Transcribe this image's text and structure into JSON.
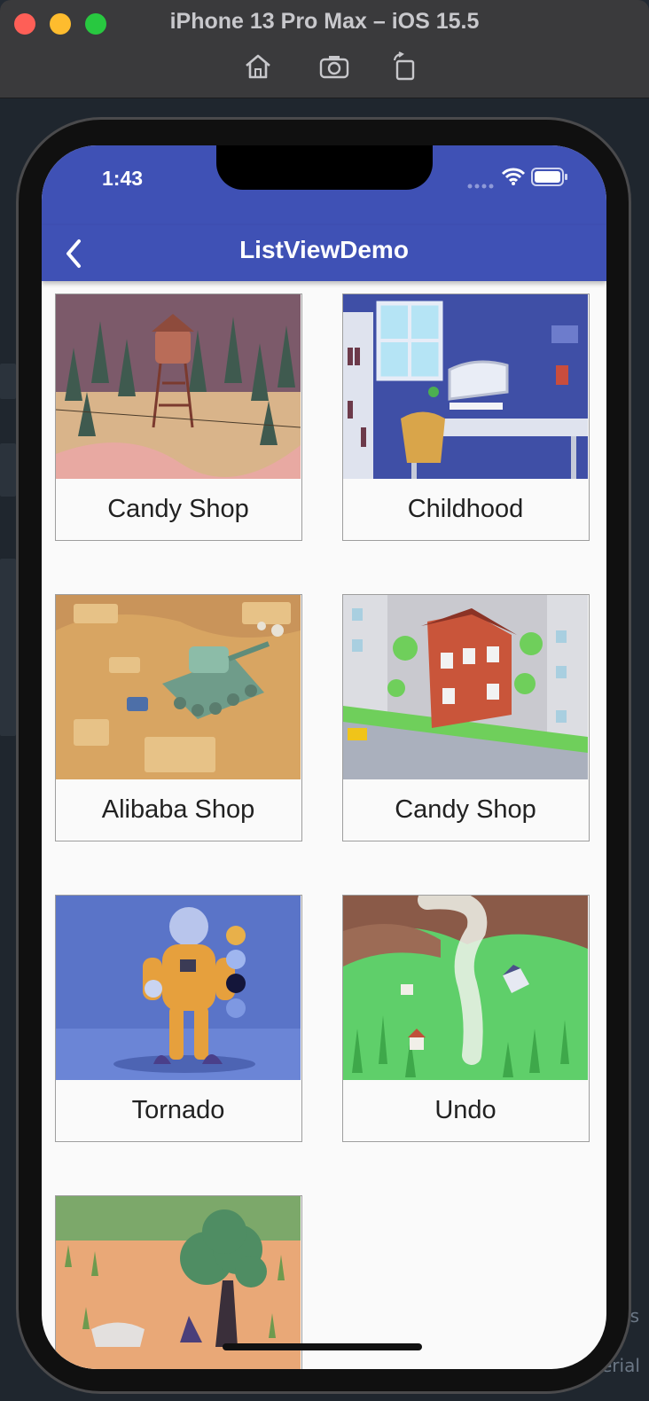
{
  "simulator": {
    "title": "iPhone 13 Pro Max – iOS 15.5",
    "traffic_lights": {
      "close": "#fe5f57",
      "minimize": "#febc2e",
      "zoom": "#28c840"
    },
    "tools": [
      "home-icon",
      "screenshot-icon",
      "rotate-icon"
    ]
  },
  "ide_background": {
    "snippets": [
      "ns",
      "erial"
    ]
  },
  "status_bar": {
    "time": "1:43",
    "icons": [
      "signal-icon",
      "wifi-icon",
      "battery-icon"
    ]
  },
  "app_bar": {
    "title": "ListViewDemo",
    "back_icon": "back-chevron-icon",
    "color": "#3f51b5"
  },
  "grid": {
    "items": [
      {
        "label": "Candy Shop",
        "scene": "water-tower-forest"
      },
      {
        "label": "Childhood",
        "scene": "isometric-room-desk"
      },
      {
        "label": "Alibaba Shop",
        "scene": "desert-tank"
      },
      {
        "label": "Candy Shop",
        "scene": "red-house-street"
      },
      {
        "label": "Tornado",
        "scene": "astronaut-character"
      },
      {
        "label": "Undo",
        "scene": "tornado-field"
      },
      {
        "label": "",
        "scene": "tree-desert-creatures"
      }
    ]
  }
}
